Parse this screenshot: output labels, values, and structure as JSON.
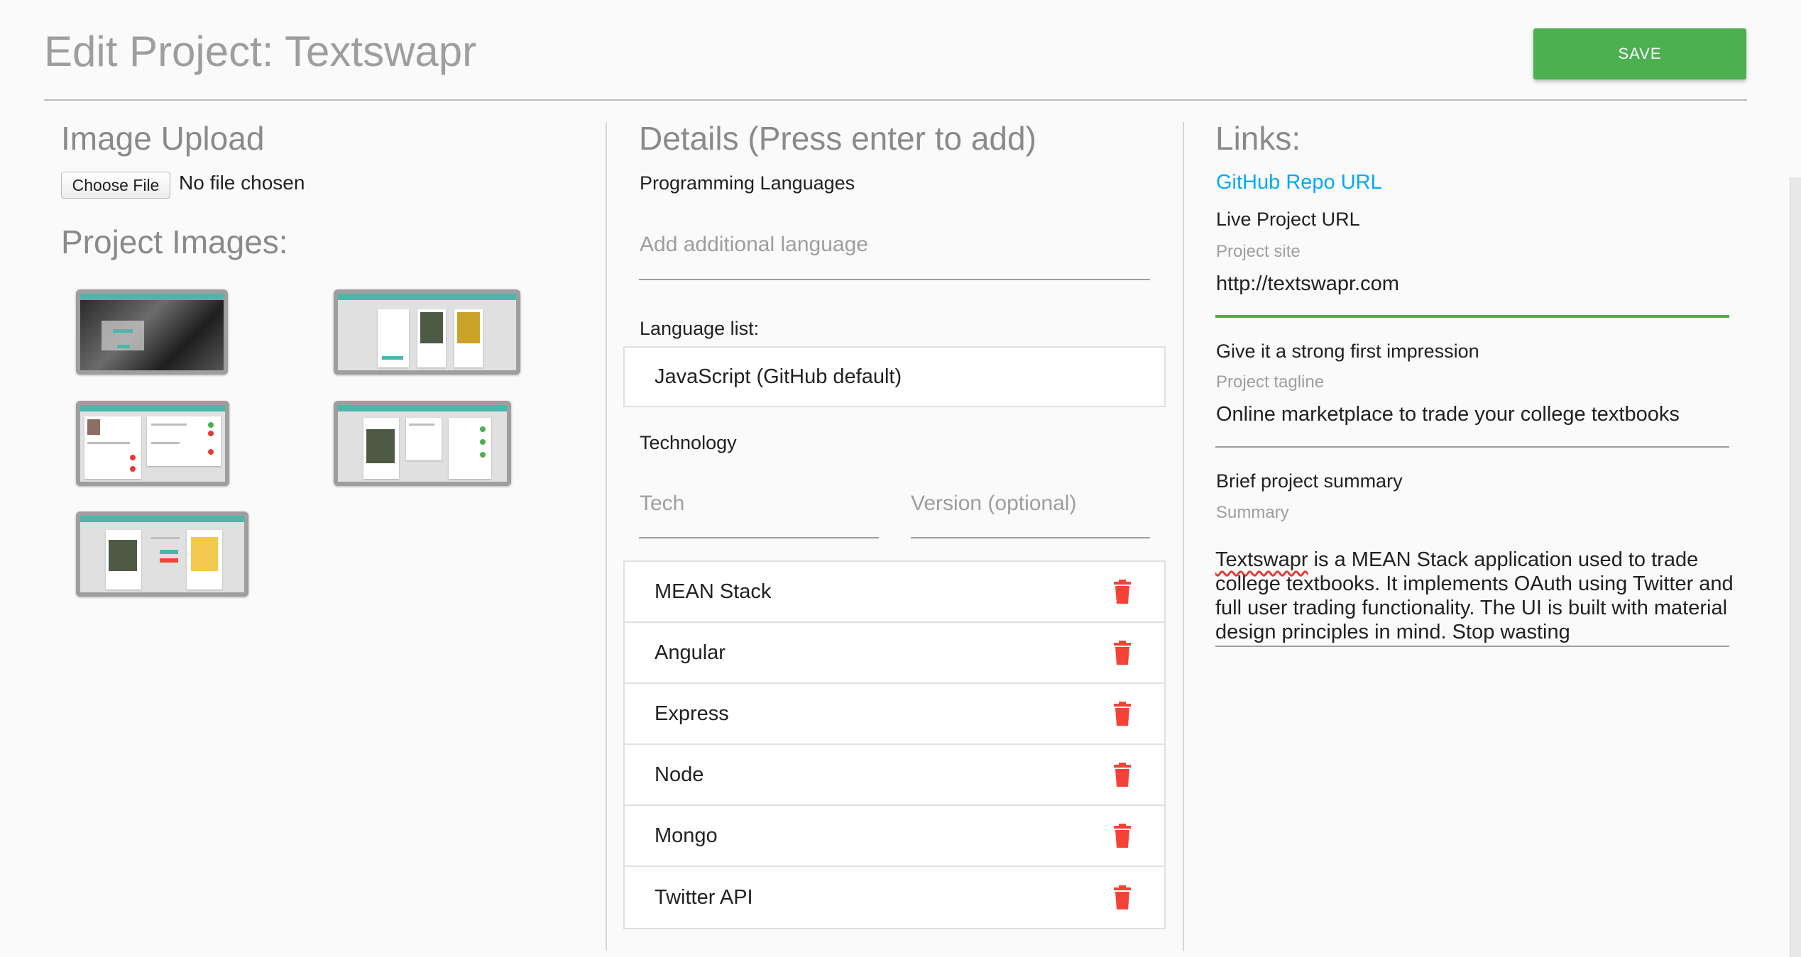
{
  "header": {
    "title": "Edit Project: Textswapr",
    "save_label": "SAVE"
  },
  "image_upload": {
    "heading": "Image Upload",
    "choose_file_label": "Choose File",
    "file_status": "No file chosen",
    "images_heading": "Project Images:"
  },
  "details": {
    "heading": "Details (Press enter to add)",
    "programming_languages_label": "Programming Languages",
    "language_placeholder": "Add additional language",
    "language_list_label": "Language list:",
    "languages": [
      "JavaScript (GitHub default)"
    ],
    "technology_label": "Technology",
    "tech_placeholder": "Tech",
    "version_placeholder": "Version (optional)",
    "technologies": [
      "MEAN Stack",
      "Angular",
      "Express",
      "Node",
      "Mongo",
      "Twitter API"
    ]
  },
  "links": {
    "heading": "Links:",
    "github_link": "GitHub Repo URL",
    "live_label": "Live Project URL",
    "site_label": "Project site",
    "site_value": "http://textswapr.com",
    "impression_label": "Give it a strong first impression",
    "tagline_label": "Project tagline",
    "tagline_value": "Online marketplace to trade your college textbooks",
    "summary_heading": "Brief project summary",
    "summary_label": "Summary",
    "summary_first_word": "Textswapr",
    "summary_rest": " is a MEAN Stack application used to trade college textbooks. It implements OAuth using Twitter and full user trading functionality. The UI is built with material design principles in mind. Stop wasting"
  },
  "colors": {
    "save": "#4caf50",
    "link": "#03a9f4",
    "delete": "#f44336",
    "accent_bar": "#4db6ac"
  },
  "icons": {
    "delete": "trash-icon"
  }
}
